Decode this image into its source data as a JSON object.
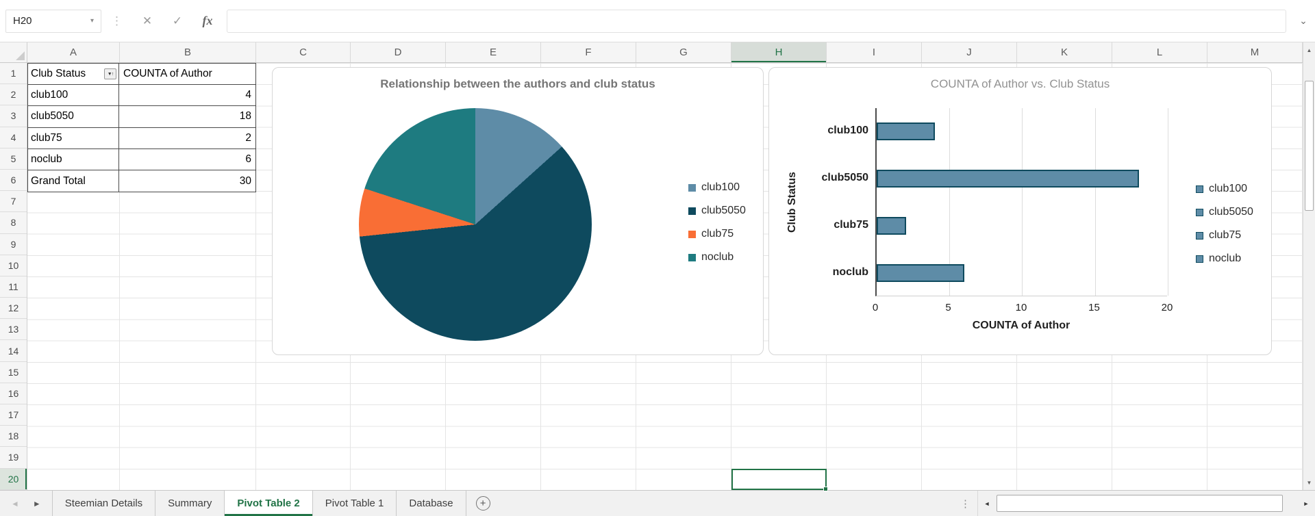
{
  "formula_bar": {
    "name_box": "H20",
    "formula_value": ""
  },
  "icons": {
    "name_box_dropdown": "▾",
    "separator_dots": "⋮",
    "cancel": "✕",
    "confirm": "✓",
    "fx": "fx",
    "formula_expand": "⌄",
    "filter_sort": "▼↑",
    "scroll_up": "▲",
    "scroll_down": "▼",
    "scroll_left": "◄",
    "scroll_right": "►",
    "tab_nav_left": "◄",
    "tab_nav_right": "►",
    "add_sheet": "+",
    "tab_options_dots": "⋮"
  },
  "grid": {
    "column_headers": [
      "A",
      "B",
      "C",
      "D",
      "E",
      "F",
      "G",
      "H",
      "I",
      "J",
      "K",
      "L",
      "M"
    ],
    "selected_column": "H",
    "row_count": 20,
    "selected_row": 20,
    "selected_cell": "H20"
  },
  "pivot_table": {
    "headers": [
      "Club Status",
      "COUNTA of Author"
    ],
    "rows": [
      {
        "label": "club100",
        "value": "4"
      },
      {
        "label": "club5050",
        "value": "18"
      },
      {
        "label": "club75",
        "value": "2"
      },
      {
        "label": "noclub",
        "value": "6"
      },
      {
        "label": "Grand Total",
        "value": "30"
      }
    ]
  },
  "chart_data": [
    {
      "type": "pie",
      "title": "Relationship between the authors and club status",
      "categories": [
        "club100",
        "club5050",
        "club75",
        "noclub"
      ],
      "values": [
        4,
        18,
        2,
        6
      ],
      "colors": [
        "#5e8ca7",
        "#0e4a5e",
        "#f96e35",
        "#1e7b80"
      ],
      "legend_position": "right"
    },
    {
      "type": "bar",
      "orientation": "horizontal",
      "title": "COUNTA of Author vs. Club Status",
      "categories": [
        "club100",
        "club5050",
        "club75",
        "noclub"
      ],
      "values": [
        4,
        18,
        2,
        6
      ],
      "xlabel": "COUNTA of Author",
      "ylabel": "Club Status",
      "xlim": [
        0,
        20
      ],
      "xticks": [
        0,
        5,
        10,
        15,
        20
      ],
      "bar_color": "#5e8ca7",
      "bar_border": "#0e4a5e",
      "grid": true,
      "legend_position": "right",
      "legend_entries": [
        "club100",
        "club5050",
        "club75",
        "noclub"
      ]
    }
  ],
  "sheet_tabs": {
    "tabs": [
      {
        "label": "Steemian Details",
        "active": false
      },
      {
        "label": "Summary",
        "active": false
      },
      {
        "label": "Pivot Table 2",
        "active": true
      },
      {
        "label": "Pivot Table 1",
        "active": false
      },
      {
        "label": "Database",
        "active": false
      }
    ]
  },
  "colors": {
    "accent_green": "#217346",
    "gridline": "#e4e4e4"
  }
}
